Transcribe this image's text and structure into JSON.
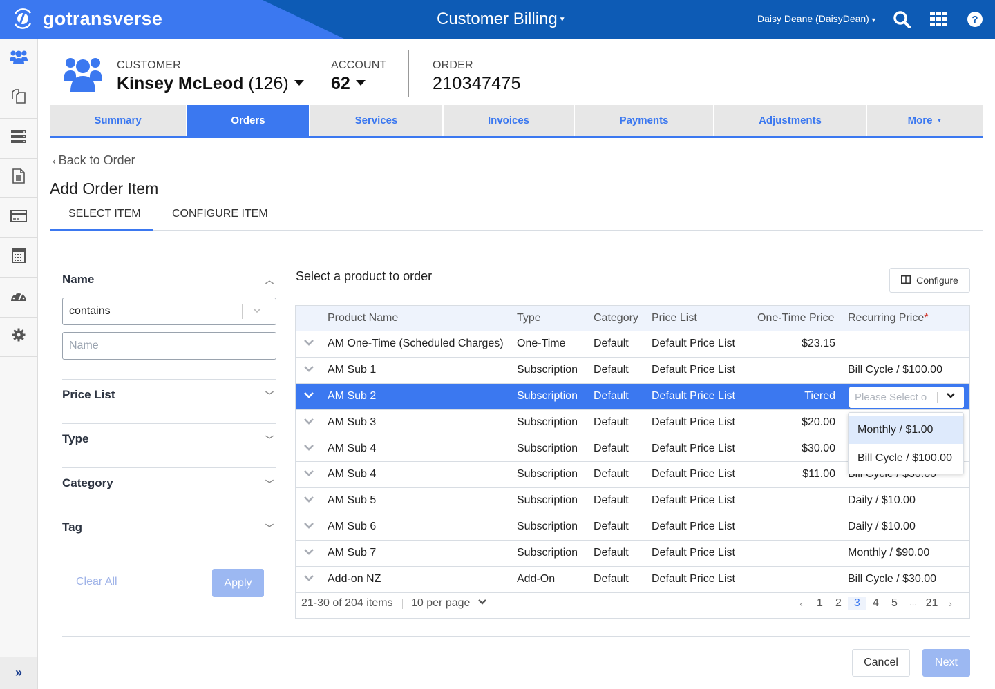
{
  "header": {
    "brand": "gotransverse",
    "app_title": "Customer Billing",
    "user": "Daisy Deane (DaisyDean)",
    "icons": [
      "search-icon",
      "apps-grid-icon",
      "help-icon"
    ]
  },
  "rail": {
    "items": [
      {
        "name": "customers",
        "icon": "users-icon",
        "active": true
      },
      {
        "name": "orders",
        "icon": "documents-icon"
      },
      {
        "name": "services",
        "icon": "server-icon"
      },
      {
        "name": "invoices",
        "icon": "file-icon"
      },
      {
        "name": "payments",
        "icon": "credit-card-icon"
      },
      {
        "name": "calculator",
        "icon": "calculator-icon"
      },
      {
        "name": "dashboard",
        "icon": "gauge-icon"
      },
      {
        "name": "settings",
        "icon": "gear-icon"
      }
    ],
    "expand": "»"
  },
  "context": {
    "customer_label": "CUSTOMER",
    "customer_name": "Kinsey McLeod",
    "customer_id": "(126)",
    "account_label": "ACCOUNT",
    "account_number": "62",
    "order_label": "ORDER",
    "order_number": "210347475"
  },
  "tabs": [
    {
      "label": "Summary"
    },
    {
      "label": "Orders",
      "active": true
    },
    {
      "label": "Services"
    },
    {
      "label": "Invoices"
    },
    {
      "label": "Payments"
    },
    {
      "label": "Adjustments"
    },
    {
      "label": "More"
    }
  ],
  "page": {
    "back_link": "Back to Order",
    "title": "Add Order Item",
    "steps": [
      {
        "label": "SELECT ITEM",
        "active": true
      },
      {
        "label": "CONFIGURE ITEM"
      }
    ]
  },
  "filters": {
    "name": {
      "label": "Name",
      "operator": "contains",
      "placeholder": "Name",
      "value": ""
    },
    "sections": [
      {
        "label": "Price List"
      },
      {
        "label": "Type"
      },
      {
        "label": "Category"
      },
      {
        "label": "Tag"
      }
    ],
    "clear_label": "Clear All",
    "apply_label": "Apply"
  },
  "grid": {
    "title": "Select a product to order",
    "configure_label": "Configure",
    "columns": [
      "Product Name",
      "Type",
      "Category",
      "Price List",
      "One-Time Price",
      "Recurring Price"
    ],
    "required_marker": "*",
    "rows": [
      {
        "name": "AM One-Time (Scheduled Charges)",
        "type": "One-Time",
        "category": "Default",
        "price_list": "Default Price List",
        "one_time": "$23.15",
        "recurring": ""
      },
      {
        "name": "AM Sub 1",
        "type": "Subscription",
        "category": "Default",
        "price_list": "Default Price List",
        "one_time": "",
        "recurring": "Bill Cycle / $100.00"
      },
      {
        "name": "AM Sub 2",
        "type": "Subscription",
        "category": "Default",
        "price_list": "Default Price List",
        "one_time": "Tiered",
        "recurring": "",
        "selected": true
      },
      {
        "name": "AM Sub 3",
        "type": "Subscription",
        "category": "Default",
        "price_list": "Default Price List",
        "one_time": "$20.00",
        "recurring": ""
      },
      {
        "name": "AM Sub 4",
        "type": "Subscription",
        "category": "Default",
        "price_list": "Default Price List",
        "one_time": "$30.00",
        "recurring": ""
      },
      {
        "name": "AM Sub 4",
        "type": "Subscription",
        "category": "Default",
        "price_list": "Default Price List",
        "one_time": "$11.00",
        "recurring": "Bill Cycle / $30.00"
      },
      {
        "name": "AM Sub 5",
        "type": "Subscription",
        "category": "Default",
        "price_list": "Default Price List",
        "one_time": "",
        "recurring": "Daily / $10.00"
      },
      {
        "name": "AM Sub 6",
        "type": "Subscription",
        "category": "Default",
        "price_list": "Default Price List",
        "one_time": "",
        "recurring": "Daily / $10.00"
      },
      {
        "name": "AM Sub 7",
        "type": "Subscription",
        "category": "Default",
        "price_list": "Default Price List",
        "one_time": "",
        "recurring": "Monthly / $90.00"
      },
      {
        "name": "Add-on NZ",
        "type": "Add-On",
        "category": "Default",
        "price_list": "Default Price List",
        "one_time": "",
        "recurring": "Bill Cycle / $30.00"
      }
    ],
    "recurring_select": {
      "placeholder": "Please Select o",
      "options": [
        "Monthly / $1.00",
        "Bill Cycle / $100.00"
      ],
      "highlighted": "Monthly / $1.00"
    },
    "pager": {
      "range": "21-30 of 204 items",
      "per_page": "10 per page",
      "prev": "‹",
      "next": "›",
      "pages": [
        "1",
        "2",
        "3",
        "4",
        "5",
        "...",
        "21"
      ],
      "current": "3"
    }
  },
  "footer": {
    "cancel_label": "Cancel",
    "next_label": "Next"
  },
  "colors": {
    "brand_blue": "#3b78f0",
    "header_dark": "#0d5bb5",
    "disabled_blue": "#9cb8f2"
  }
}
